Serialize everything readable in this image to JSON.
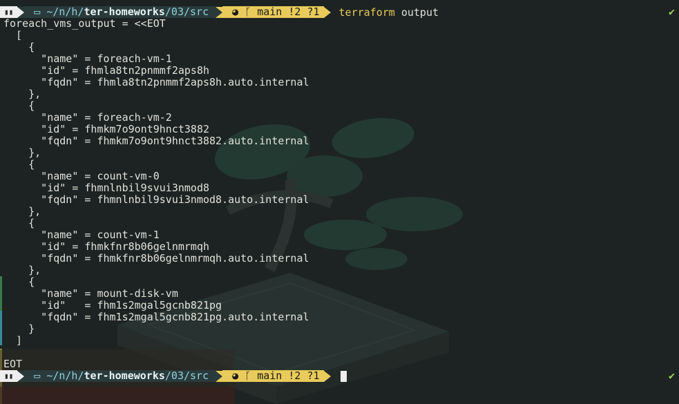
{
  "prompt1": {
    "os_icon": "terminal-icon",
    "home_icon": "folder-icon",
    "path_prefix": "~/n/h/",
    "path_bold": "ter-homeworks",
    "path_suffix": "/03/src",
    "git_icon": "octocat-icon",
    "branch_icon": "branch-icon",
    "branch": "main",
    "status": "!2 ?1",
    "command": "terraform",
    "command_arg": "output",
    "check": "✔"
  },
  "output_lines": [
    "foreach_vms_output = <<EOT",
    "  [",
    "    {",
    "      \"name\" = foreach-vm-1",
    "      \"id\" = fhmla8tn2pnmmf2aps8h",
    "      \"fqdn\" = fhmla8tn2pnmmf2aps8h.auto.internal",
    "    },",
    "    {",
    "      \"name\" = foreach-vm-2",
    "      \"id\" = fhmkm7o9ont9hnct3882",
    "      \"fqdn\" = fhmkm7o9ont9hnct3882.auto.internal",
    "    },",
    "    {",
    "      \"name\" = count-vm-0",
    "      \"id\" = fhmnlnbil9svui3nmod8",
    "      \"fqdn\" = fhmnlnbil9svui3nmod8.auto.internal",
    "    },",
    "    {",
    "      \"name\" = count-vm-1",
    "      \"id\" = fhmkfnr8b06gelnmrmqh",
    "      \"fqdn\" = fhmkfnr8b06gelnmrmqh.auto.internal",
    "    },",
    "    {",
    "      \"name\" = mount-disk-vm",
    "      \"id\"   = fhm1s2mgal5gcnb821pg",
    "      \"fqdn\" = fhm1s2mgal5gcnb821pg.auto.internal",
    "    }",
    "  ]",
    "",
    "EOT"
  ],
  "prompt2": {
    "path_prefix": "~/n/h/",
    "path_bold": "ter-homeworks",
    "path_suffix": "/03/src",
    "branch": "main",
    "status": "!2 ?1",
    "check": "✔"
  },
  "colors": {
    "background": "#1d2322",
    "path_segment": "#2a3a3b",
    "git_segment": "#e8cb5a",
    "command": "#e8cb5a",
    "success": "#9ed45a"
  }
}
